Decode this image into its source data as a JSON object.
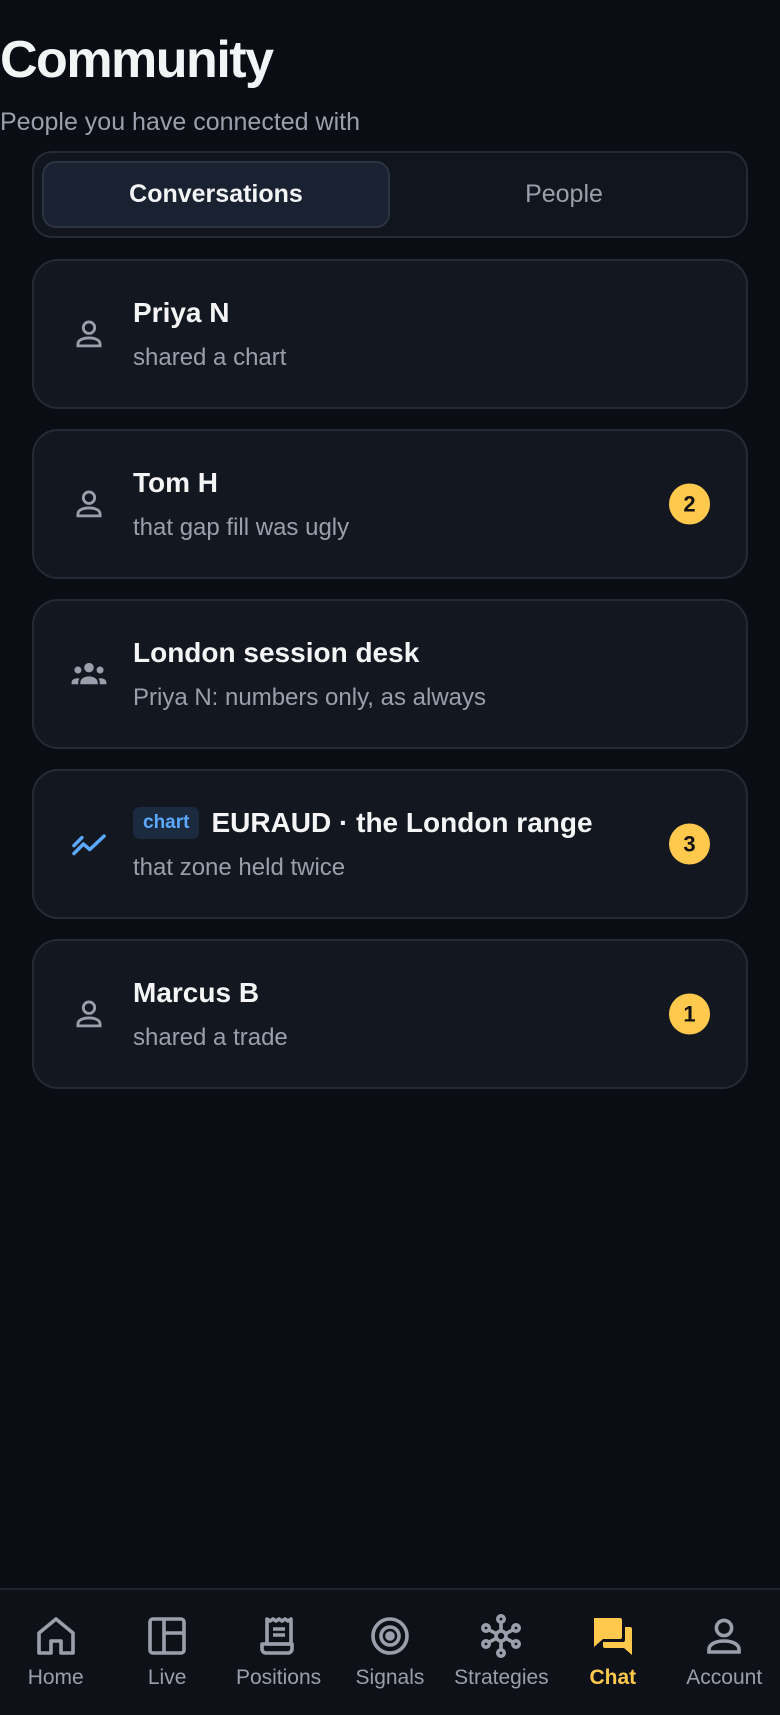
{
  "header": {
    "title": "Community",
    "subtitle": "People you have connected with"
  },
  "tabs": [
    {
      "label": "Conversations",
      "active": true
    },
    {
      "label": "People",
      "active": false
    }
  ],
  "conversations": [
    {
      "icon": "person-icon",
      "name": "Priya N",
      "preview": "shared a chart",
      "unread": ""
    },
    {
      "icon": "person-icon",
      "name": "Tom H",
      "preview": "that gap fill was ugly",
      "unread": "2"
    },
    {
      "icon": "group-icon",
      "name": "London session desk",
      "preview": "Priya N: numbers only, as always",
      "unread": ""
    },
    {
      "icon": "chart-line-icon",
      "tag": "chart",
      "name": "EURAUD · the London range",
      "preview": "that zone held twice",
      "unread": "3"
    },
    {
      "icon": "person-icon",
      "name": "Marcus B",
      "preview": "shared a trade",
      "unread": "1"
    }
  ],
  "nav": [
    {
      "icon": "home-icon",
      "label": "Home",
      "active": false
    },
    {
      "icon": "live-icon",
      "label": "Live",
      "active": false
    },
    {
      "icon": "receipt-icon",
      "label": "Positions",
      "active": false
    },
    {
      "icon": "signals-icon",
      "label": "Signals",
      "active": false
    },
    {
      "icon": "strategies-icon",
      "label": "Strategies",
      "active": false
    },
    {
      "icon": "chat-icon",
      "label": "Chat",
      "active": true
    },
    {
      "icon": "account-icon",
      "label": "Account",
      "active": false
    }
  ],
  "colors": {
    "background": "#0a0d14",
    "card": "#131720",
    "accent": "#ffc94d",
    "tag": "#5aa9ff",
    "muted": "#9aa0ab"
  }
}
